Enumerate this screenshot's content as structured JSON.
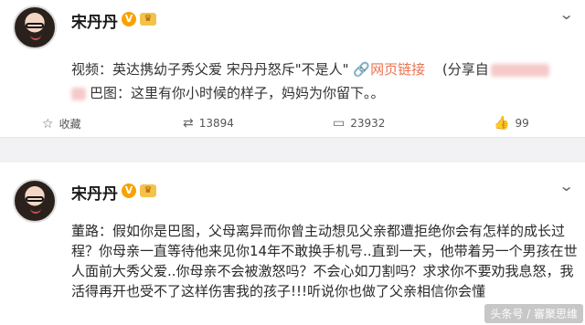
{
  "post1": {
    "author": "宋丹丹",
    "v_badge": "V",
    "video_prefix": "视频：",
    "video_title": "英达携幼子秀父爱 宋丹丹怒斥\"不是人\"",
    "link_icon": "link-icon",
    "link_label": "网页链接",
    "share_prefix": "(分享自",
    "body_line2": "巴图：这里有你小时候的样子，妈妈为你留下。。",
    "actions": {
      "favorite_label": "收藏",
      "repost_count": "13894",
      "comment_count": "23932",
      "like_count": "99"
    }
  },
  "post2": {
    "author": "宋丹丹",
    "v_badge": "V",
    "lines": [
      "董路：假如你是巴图，父母离异而你曾主动想见父亲都遭拒绝你会有怎样的成长过",
      "程？你母亲一直等待他来见你14年不敢换手机号..直到一天，他带着另一个男孩在世",
      "人面前大秀父爱..你母亲不会被激怒吗？不会心如刀割吗？求求你不要劝我息怒，我",
      "活得再开也受不了这样伤害我的孩子!!!听说你也做了父亲相信你会懂"
    ]
  },
  "watermark": "头条号 / 審聚思维",
  "colors": {
    "link": "#eb7350",
    "verified": "#f7a200",
    "divider": "#f2f2f5"
  }
}
